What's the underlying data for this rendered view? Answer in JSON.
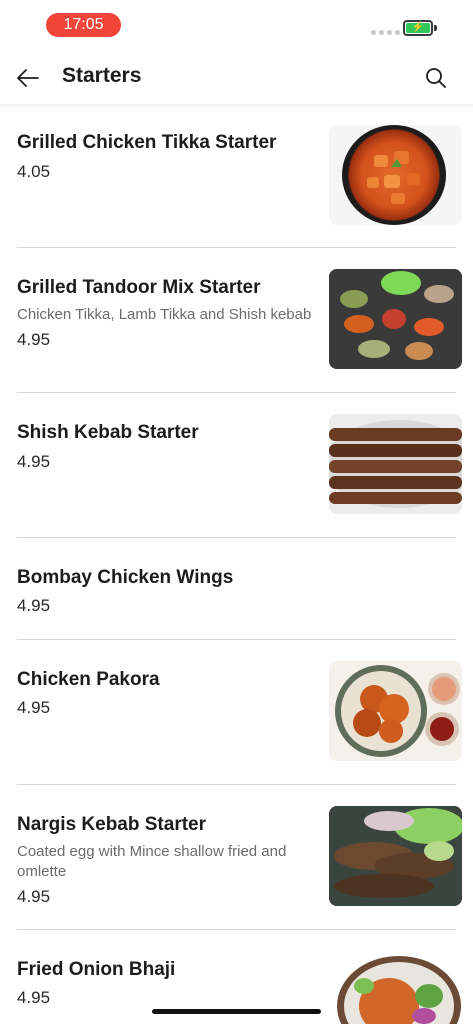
{
  "status_bar": {
    "time": "17:05"
  },
  "header": {
    "title": "Starters"
  },
  "menu": {
    "items": [
      {
        "name": "Grilled Chicken Tikka Starter",
        "description": "",
        "price": "4.05",
        "image": "chicken-tikka-bowl"
      },
      {
        "name": "Grilled Tandoor Mix Starter",
        "description": "Chicken Tikka, Lamb Tikka and Shish kebab",
        "price": "4.95",
        "image": "tandoor-mix-platter"
      },
      {
        "name": "Shish Kebab Starter",
        "description": "",
        "price": "4.95",
        "image": "shish-kebab-skewers"
      },
      {
        "name": "Bombay Chicken Wings",
        "description": "",
        "price": "4.95",
        "image": ""
      },
      {
        "name": "Chicken Pakora",
        "description": "",
        "price": "4.95",
        "image": "chicken-pakora-plate"
      },
      {
        "name": "Nargis Kebab Starter",
        "description": "Coated egg with Mince shallow fried and omlette",
        "price": "4.95",
        "image": "nargis-kebab-platter"
      },
      {
        "name": "Fried Onion Bhaji",
        "description": "",
        "price": "4.95",
        "image": "onion-bhaji-bowl"
      }
    ]
  },
  "colors": {
    "accent": "#f2453a",
    "battery": "#34c759"
  }
}
